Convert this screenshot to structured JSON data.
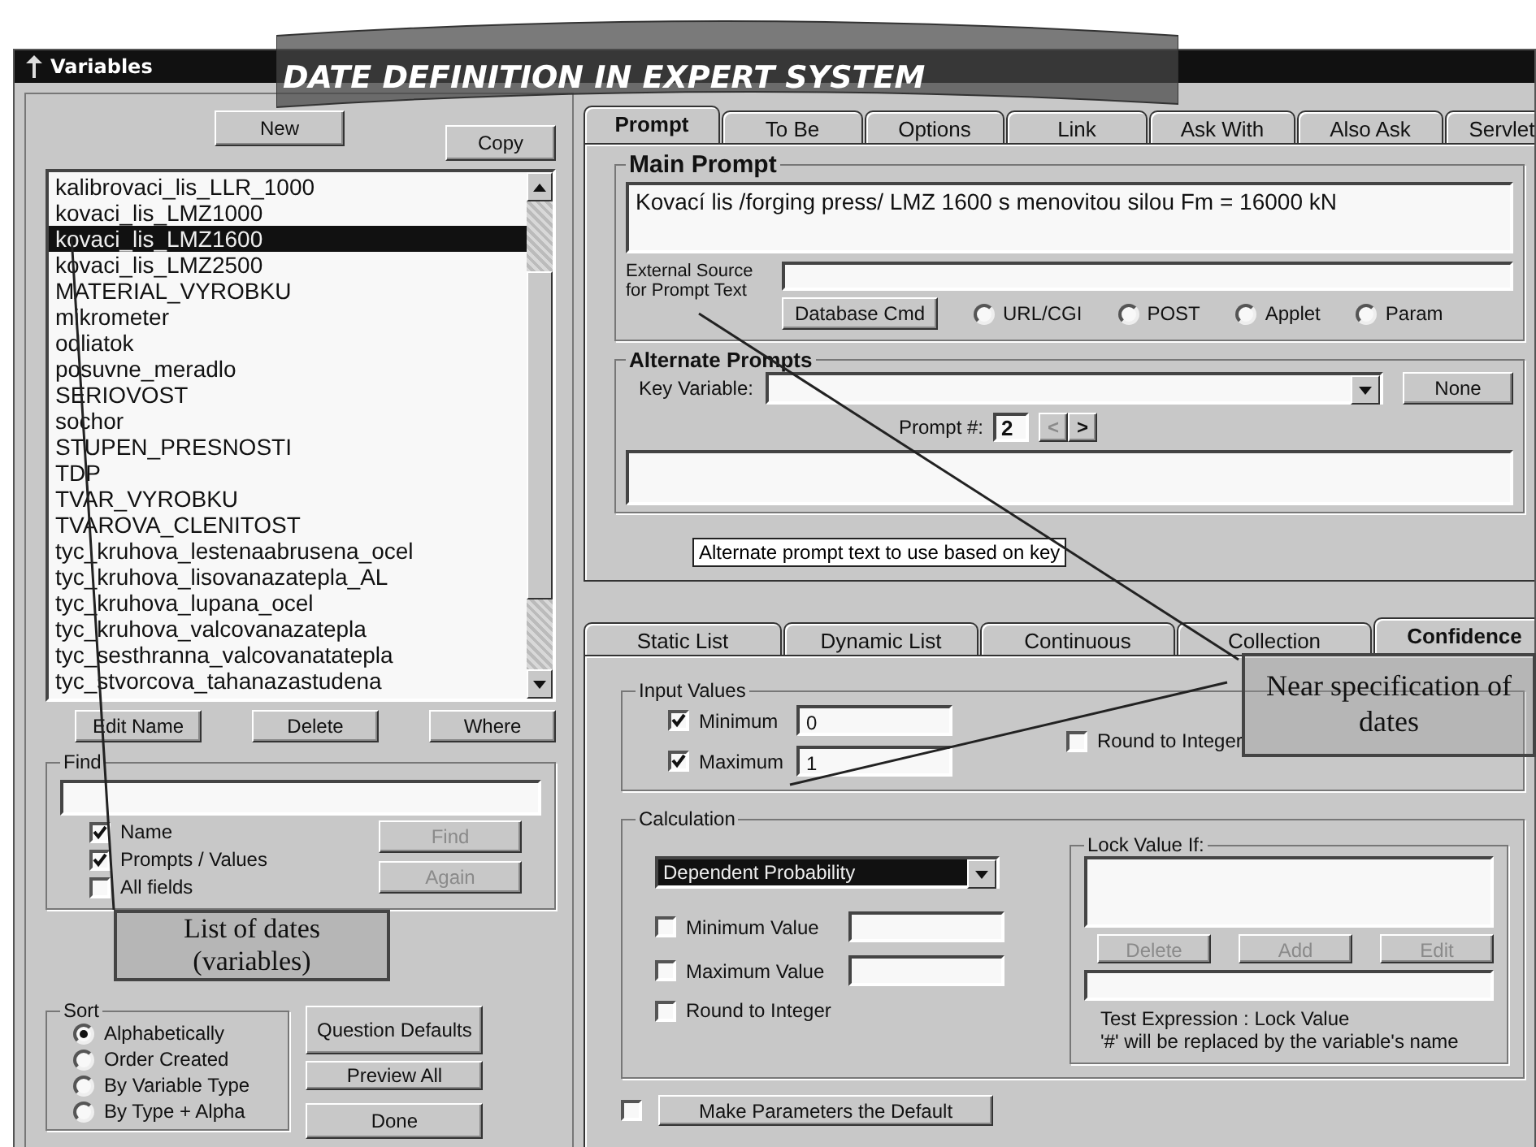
{
  "window": {
    "title": "Variables"
  },
  "banner": {
    "title": "DATE DEFINITION IN EXPERT SYSTEM"
  },
  "variables_panel": {
    "top_buttons": [
      {
        "label": "New"
      },
      {
        "label": "Copy"
      }
    ],
    "variables": [
      {
        "name": "kalibrovaci_lis_LLR_1000",
        "selected": false
      },
      {
        "name": "kovaci_lis_LMZ1000",
        "selected": false
      },
      {
        "name": "kovaci_lis_LMZ1600",
        "selected": true
      },
      {
        "name": "kovaci_lis_LMZ2500",
        "selected": false
      },
      {
        "name": "MATERIAL_VYROBKU",
        "selected": false
      },
      {
        "name": "mikrometer",
        "selected": false
      },
      {
        "name": "odliatok",
        "selected": false
      },
      {
        "name": "posuvne_meradlo",
        "selected": false
      },
      {
        "name": "SERIOVOST",
        "selected": false
      },
      {
        "name": "sochor",
        "selected": false
      },
      {
        "name": "STUPEN_PRESNOSTI",
        "selected": false
      },
      {
        "name": "TDP",
        "selected": false
      },
      {
        "name": "TVAR_VYROBKU",
        "selected": false
      },
      {
        "name": "TVAROVA_CLENITOST",
        "selected": false
      },
      {
        "name": "tyc_kruhova_lestenaabrusena_ocel",
        "selected": false
      },
      {
        "name": "tyc_kruhova_lisovanazatepla_AL",
        "selected": false
      },
      {
        "name": "tyc_kruhova_lupana_ocel",
        "selected": false
      },
      {
        "name": "tyc_kruhova_valcovanazatepla",
        "selected": false
      },
      {
        "name": "tyc_sesthranna_valcovanatatepla",
        "selected": false
      },
      {
        "name": "tyc_stvorcova_tahanazastudena",
        "selected": false
      }
    ],
    "list_buttons": [
      "Edit Name",
      "Delete",
      "Where"
    ],
    "find": {
      "title": "Find",
      "options": [
        {
          "label": "Name",
          "checked": true
        },
        {
          "label": "Prompts / Values",
          "checked": true
        },
        {
          "label": "All fields",
          "checked": false
        }
      ],
      "buttons": [
        {
          "label": "Find",
          "disabled": true
        },
        {
          "label": "Again",
          "disabled": true
        }
      ]
    },
    "sort": {
      "title": "Sort",
      "options": [
        {
          "label": "Alphabetically",
          "selected": true
        },
        {
          "label": "Order Created",
          "selected": false
        },
        {
          "label": "By Variable Type",
          "selected": false
        },
        {
          "label": "By Type + Alpha",
          "selected": false
        }
      ]
    },
    "side_buttons": [
      "Question Defaults",
      "Preview All"
    ],
    "done_button": "Done"
  },
  "prompt_tabs": [
    {
      "label": "Prompt",
      "selected": true
    },
    {
      "label": "To Be",
      "selected": false
    },
    {
      "label": "Options",
      "selected": false
    },
    {
      "label": "Link",
      "selected": false
    },
    {
      "label": "Ask With",
      "selected": false
    },
    {
      "label": "Also Ask",
      "selected": false
    },
    {
      "label": "Servlet",
      "selected": false
    }
  ],
  "main_prompt": {
    "title": "Main Prompt",
    "text": "Kovací lis /forging press/ LMZ 1600 s menovitou silou Fm = 16000 kN",
    "external_source_label": "External Source for Prompt Text",
    "database_button": "Database Cmd",
    "source_options": [
      {
        "label": "URL/CGI",
        "selected": false
      },
      {
        "label": "POST",
        "selected": false
      },
      {
        "label": "Applet",
        "selected": false
      },
      {
        "label": "Param",
        "selected": false
      }
    ]
  },
  "alternate_prompts": {
    "title": "Alternate Prompts",
    "key_variable_label": "Key Variable:",
    "none_button": "None",
    "prompt_number_label": "Prompt #:",
    "prompt_number": "2",
    "nav_buttons": [
      {
        "label": "<",
        "disabled": true
      },
      {
        "label": ">",
        "disabled": false
      }
    ],
    "tooltip": "Alternate prompt text to use based on key"
  },
  "value_tabs": [
    {
      "label": "Static List",
      "selected": false
    },
    {
      "label": "Dynamic List",
      "selected": false
    },
    {
      "label": "Continuous",
      "selected": false
    },
    {
      "label": "Collection",
      "selected": false
    },
    {
      "label": "Confidence",
      "selected": true
    }
  ],
  "input_values": {
    "title": "Input Values",
    "fields": [
      {
        "label": "Minimum",
        "checked": true,
        "value": "0"
      },
      {
        "label": "Maximum",
        "checked": true,
        "value": "1"
      }
    ],
    "round_to_integer": {
      "label": "Round to Integer",
      "checked": false
    }
  },
  "calculation": {
    "title": "Calculation",
    "method": "Dependent Probability",
    "options": [
      {
        "label": "Minimum Value",
        "checked": false,
        "kind": "field"
      },
      {
        "label": "Maximum Value",
        "checked": false,
        "kind": "field"
      },
      {
        "label": "Round to Integer",
        "checked": false,
        "kind": "plain"
      }
    ],
    "lock_value": {
      "title": "Lock Value If:",
      "buttons": [
        {
          "label": "Delete",
          "disabled": true
        },
        {
          "label": "Add",
          "disabled": true
        },
        {
          "label": "Edit",
          "disabled": true
        }
      ],
      "note": [
        "Test Expression : Lock Value",
        "'#' will be replaced by the variable's  name"
      ]
    }
  },
  "make_default": {
    "label": "Make Parameters the Default",
    "checked": false
  },
  "callouts": [
    {
      "text": "List of dates (variables)"
    },
    {
      "text": "Near specification of dates"
    }
  ]
}
